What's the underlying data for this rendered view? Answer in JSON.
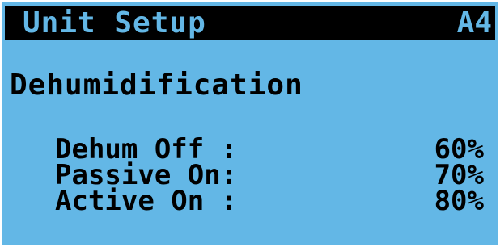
{
  "header": {
    "title": "Unit Setup",
    "screen_code": "A4"
  },
  "section": {
    "title": "Dehumidification"
  },
  "setpoints": [
    {
      "label": "Dehum Off :",
      "value": "60%"
    },
    {
      "label": "Passive On:",
      "value": "70%"
    },
    {
      "label": "Active On :",
      "value": "80%"
    }
  ],
  "colors": {
    "lcd_background": "#63b7e6",
    "title_bar": "#000000",
    "text": "#000000"
  }
}
